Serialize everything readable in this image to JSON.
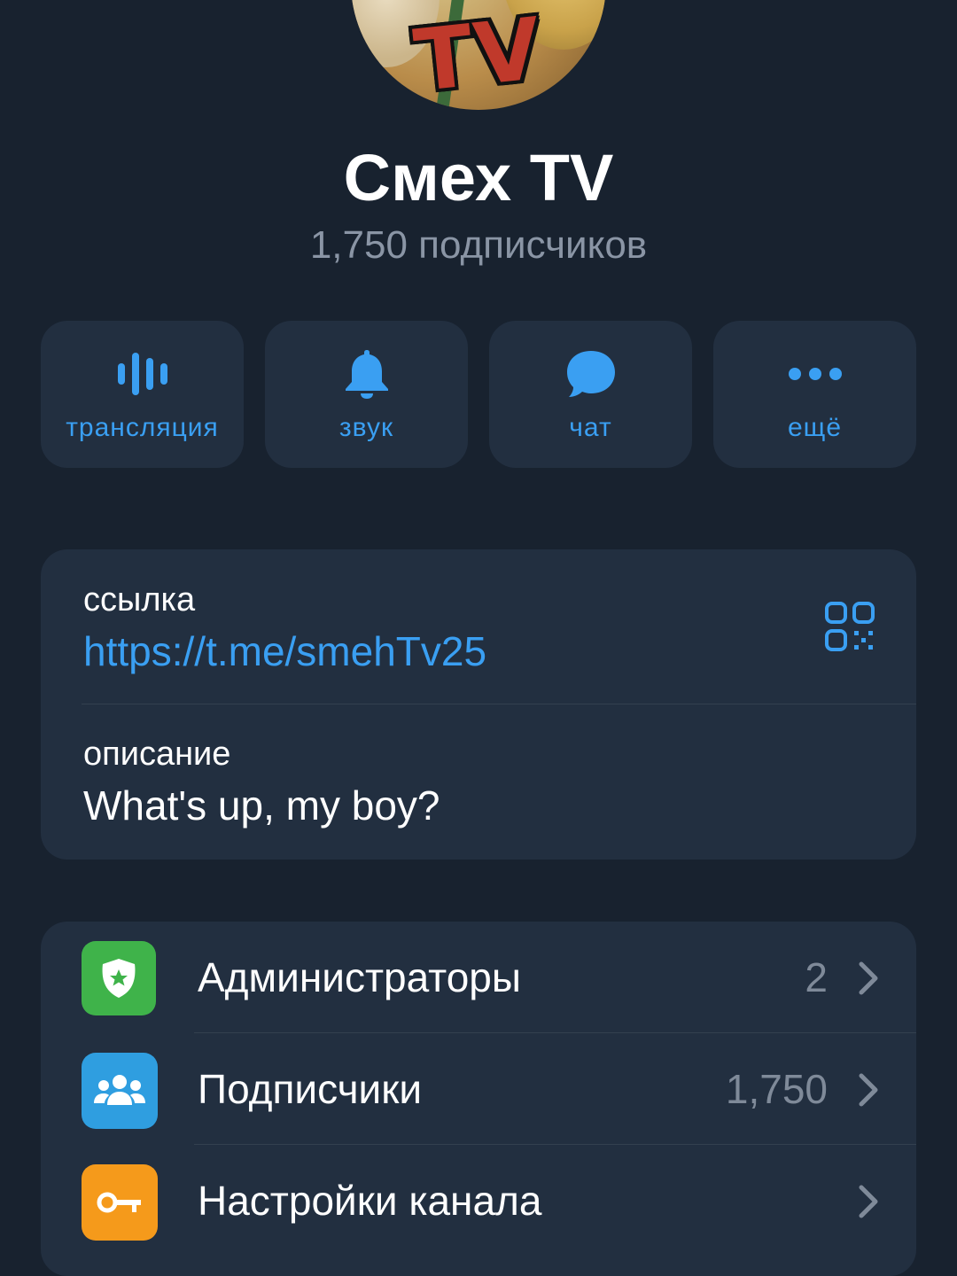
{
  "channel": {
    "avatar_text": "TV",
    "title": "Смех TV",
    "subscribers_text": "1,750 подписчиков"
  },
  "actions": [
    {
      "label": "трансляция",
      "icon": "broadcast-icon"
    },
    {
      "label": "звук",
      "icon": "bell-icon"
    },
    {
      "label": "чат",
      "icon": "chat-bubble-icon"
    },
    {
      "label": "ещё",
      "icon": "more-dots-icon"
    }
  ],
  "info": {
    "link_label": "ссылка",
    "link_value": "https://t.me/smehTv25",
    "description_label": "описание",
    "description_value": "What's up, my boy?"
  },
  "menu": [
    {
      "label": "Администраторы",
      "value": "2",
      "icon": "admin-shield-icon",
      "color": "#3fb34a"
    },
    {
      "label": "Подписчики",
      "value": "1,750",
      "icon": "people-group-icon",
      "color": "#2f9ee0"
    },
    {
      "label": "Настройки канала",
      "value": "",
      "icon": "key-icon",
      "color": "#f59a1b"
    }
  ],
  "colors": {
    "background": "#18222f",
    "card": "#222f40",
    "accent": "#3a9ff2"
  }
}
